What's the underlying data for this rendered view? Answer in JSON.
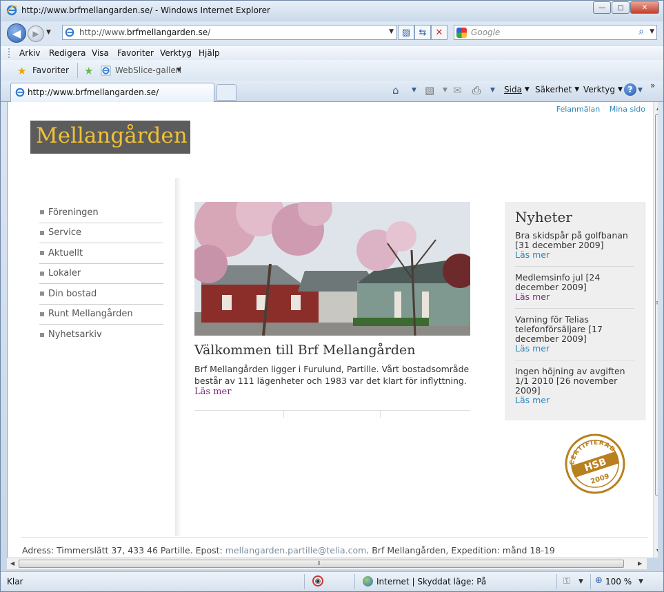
{
  "window": {
    "title": "http://www.brfmellangarden.se/ - Windows Internet Explorer",
    "minimize_glyph": "—",
    "maximize_glyph": "▢",
    "close_glyph": "✕"
  },
  "address": {
    "url_prefix": "http://www.",
    "url_domain": "brfmellangarden.se",
    "url_suffix": "/",
    "search_placeholder": "Google"
  },
  "menu": {
    "items": [
      "Arkiv",
      "Redigera",
      "Visa",
      "Favoriter",
      "Verktyg",
      "Hjälp"
    ]
  },
  "favorites_bar": {
    "favorites_label": "Favoriter",
    "webslice_label": "WebSlice-galleri"
  },
  "tabs": {
    "active_label": "http://www.brfmellangarden.se/"
  },
  "command_bar": {
    "page": "Sida",
    "safety": "Säkerhet",
    "tools": "Verktyg",
    "more": "»"
  },
  "page": {
    "top_links": [
      "Felanmälan",
      "Mina sido"
    ],
    "logo": "Mellangården",
    "nav": [
      "Föreningen",
      "Service",
      "Aktuellt",
      "Lokaler",
      "Din bostad",
      "Runt Mellangården",
      "Nyhetsarkiv"
    ],
    "main": {
      "title": "Välkommen till Brf Mellangården",
      "body": "Brf Mellangården ligger i Furulund, Partille. Vårt bostadsområde består av 111 lägenheter och 1983 var det klart för inflyttning.",
      "more": "Läs mer"
    },
    "news": {
      "title": "Nyheter",
      "items": [
        {
          "text": "Bra skidspår på golfbanan [31 december 2009]",
          "more": "Läs mer"
        },
        {
          "text": "Medlemsinfo jul [24 december 2009]",
          "more": "Läs mer"
        },
        {
          "text": "Varning för Telias telefonförsäljare [17 december 2009]",
          "more": "Läs mer"
        },
        {
          "text": "Ingen höjning av avgiften 1/1 2010 [26 november 2009]",
          "more": "Läs mer"
        }
      ]
    },
    "seal": {
      "top_text": "CERTIFIERAD",
      "center_text": "HSB",
      "year": "2009"
    },
    "footer": {
      "prefix": "Adress: Timmerslätt 37, 433 46 Partille. Epost: ",
      "email": "mellangarden.partille@telia.com",
      "suffix": ". Brf Mellangården, Expedition: månd 18-19"
    }
  },
  "status": {
    "text": "Klar",
    "zone": "Internet | Skyddat läge: På",
    "zoom": "100 %"
  },
  "colors": {
    "logo_bg": "#5c5c5c",
    "logo_text": "#f1c232",
    "link_blue": "#2e86b8",
    "link_visited": "#7b2a7a",
    "news_bg": "#efefef",
    "seal": "#b8801e"
  }
}
